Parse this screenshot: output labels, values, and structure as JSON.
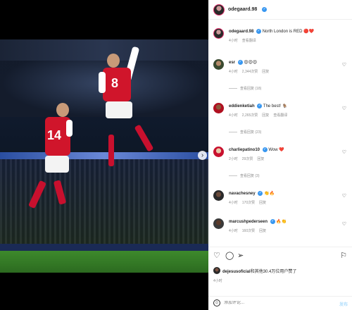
{
  "post": {
    "author": "odegaard.98",
    "caption": "North London is RED",
    "caption_emojis": "🔴❤️",
    "caption_time": "4小时",
    "caption_translate": "查看翻译"
  },
  "comments": [
    {
      "user": "esr",
      "text": "😍😍😍",
      "time": "4小时",
      "likes": "2,344次赞",
      "reply": "回复",
      "replies": "查看回复 (18)"
    },
    {
      "user": "eddienketiah",
      "text": "The best! 🐐",
      "time": "4小时",
      "likes": "2,265次赞",
      "reply": "回复",
      "translate": "查看翻译",
      "replies": "查看回复 (23)"
    },
    {
      "user": "charliepatino10",
      "text": "Wow ❤️",
      "time": "2小时",
      "likes": "29次赞",
      "reply": "回复",
      "replies": "查看回复 (3)"
    },
    {
      "user": "navachesney",
      "text": "👏🔥",
      "time": "4小时",
      "likes": "170次赞",
      "reply": "回复"
    },
    {
      "user": "marcushpederseen",
      "text": "🔥👏",
      "time": "4小时",
      "likes": "160次赞",
      "reply": "回复"
    }
  ],
  "likes": {
    "by": "dejesusoficial",
    "others": "和其他30.4万位用户赞了"
  },
  "post_time": "4小时",
  "composer": {
    "placeholder": "添加评论...",
    "post_label": "发布"
  },
  "icons": {
    "like": "heart-icon",
    "comment": "comment-icon",
    "share": "share-icon",
    "save": "bookmark-icon",
    "emoji": "emoji-icon",
    "next": "chevron-right-icon"
  },
  "photo": {
    "player_numbers": [
      "8",
      "14"
    ],
    "carousel_count": 3,
    "carousel_active": 1
  }
}
